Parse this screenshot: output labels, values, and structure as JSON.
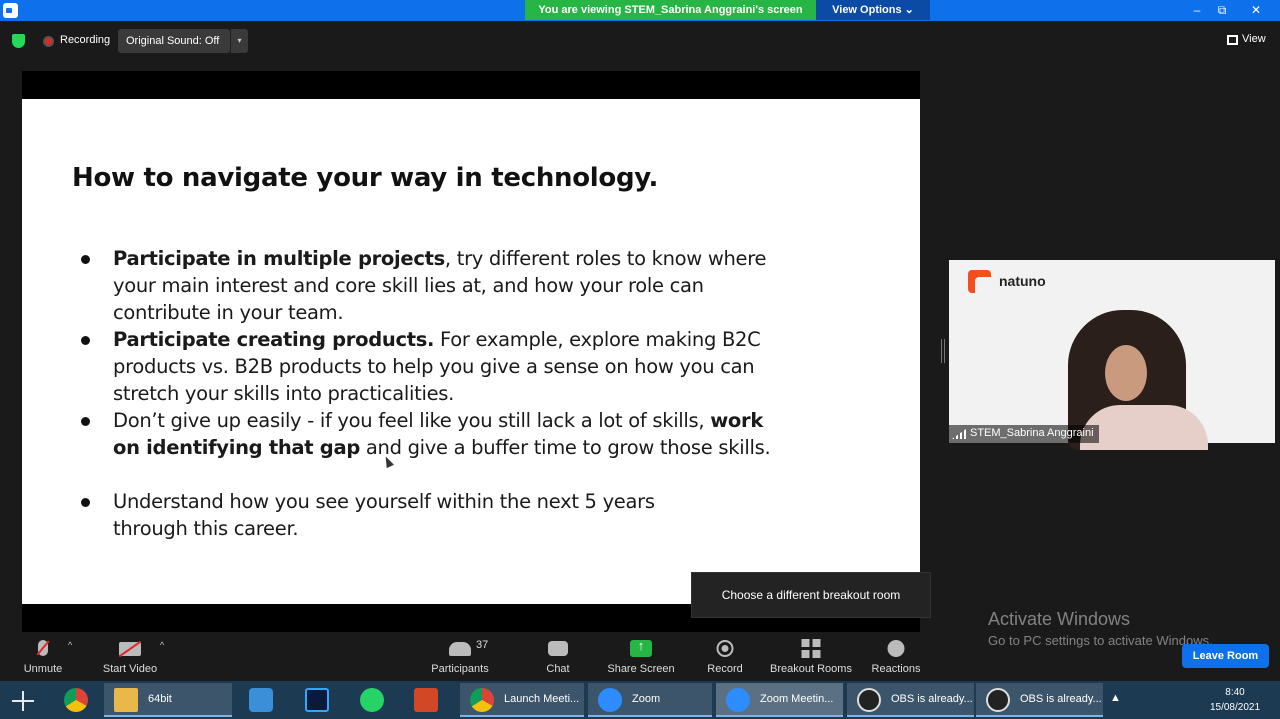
{
  "window": {
    "viewing_banner": "You are viewing STEM_Sabrina Anggraini's screen",
    "view_options": "View Options ⌄",
    "minimize": "–",
    "maximize": "⧉",
    "close": "✕"
  },
  "topbar": {
    "recording": "Recording",
    "original_sound": "Original Sound: Off",
    "sound_caret": "▾",
    "view": "View"
  },
  "slide": {
    "title": "How to navigate your way in technology.",
    "bullets": [
      {
        "bold": "Participate in multiple projects",
        "rest": ", try different roles to know where your main interest and core skill lies at, and how your role can contribute in your team."
      },
      {
        "bold": "Participate creating products.",
        "rest": " For example, explore making B2C products vs. B2B products to help you give a sense on how you can stretch your skills into practicalities."
      },
      {
        "pre": "Don’t give up easily - if you feel like you still lack a lot of skills, ",
        "bold": "work on identifying that gap",
        "rest": " and give a buffer time to grow those skills."
      },
      {
        "text": "Understand how you see yourself within the next 5 years through this career."
      }
    ]
  },
  "video": {
    "brand": "natuno",
    "participant_name": "STEM_Sabrina Anggraini"
  },
  "tooltip": "Choose a different breakout room",
  "watermark": {
    "title": "Activate Windows",
    "subtitle": "Go to PC settings to activate Windows."
  },
  "toolbar": {
    "unmute": "Unmute",
    "start_video": "Start Video",
    "participants": "Participants",
    "participant_count": "37",
    "chat": "Chat",
    "share_screen": "Share Screen",
    "record": "Record",
    "breakout_rooms": "Breakout Rooms",
    "reactions": "Reactions",
    "leave_room": "Leave Room",
    "caret": "^"
  },
  "taskbar": {
    "apps": [
      "64bit",
      "Launch Meeti...",
      "Zoom",
      "Zoom Meetin...",
      "OBS is already...",
      "OBS is already..."
    ],
    "time": "8:40",
    "date": "15/08/2021",
    "tray_caret": "▲"
  },
  "colors": {
    "zoom_blue": "#0e71eb",
    "share_green": "#27b645",
    "muted_red": "#e02828"
  },
  "icons": [
    "zoom-icon",
    "shield-icon",
    "record-dot-icon",
    "grid-view-icon",
    "mic-muted-icon",
    "video-off-icon",
    "participants-icon",
    "chat-icon",
    "share-screen-icon",
    "record-icon",
    "breakout-rooms-icon",
    "reactions-icon",
    "windows-start-icon",
    "chrome-icon",
    "folder-icon",
    "calculator-icon",
    "photoshop-icon",
    "whatsapp-icon",
    "powerpoint-icon",
    "obs-icon"
  ]
}
